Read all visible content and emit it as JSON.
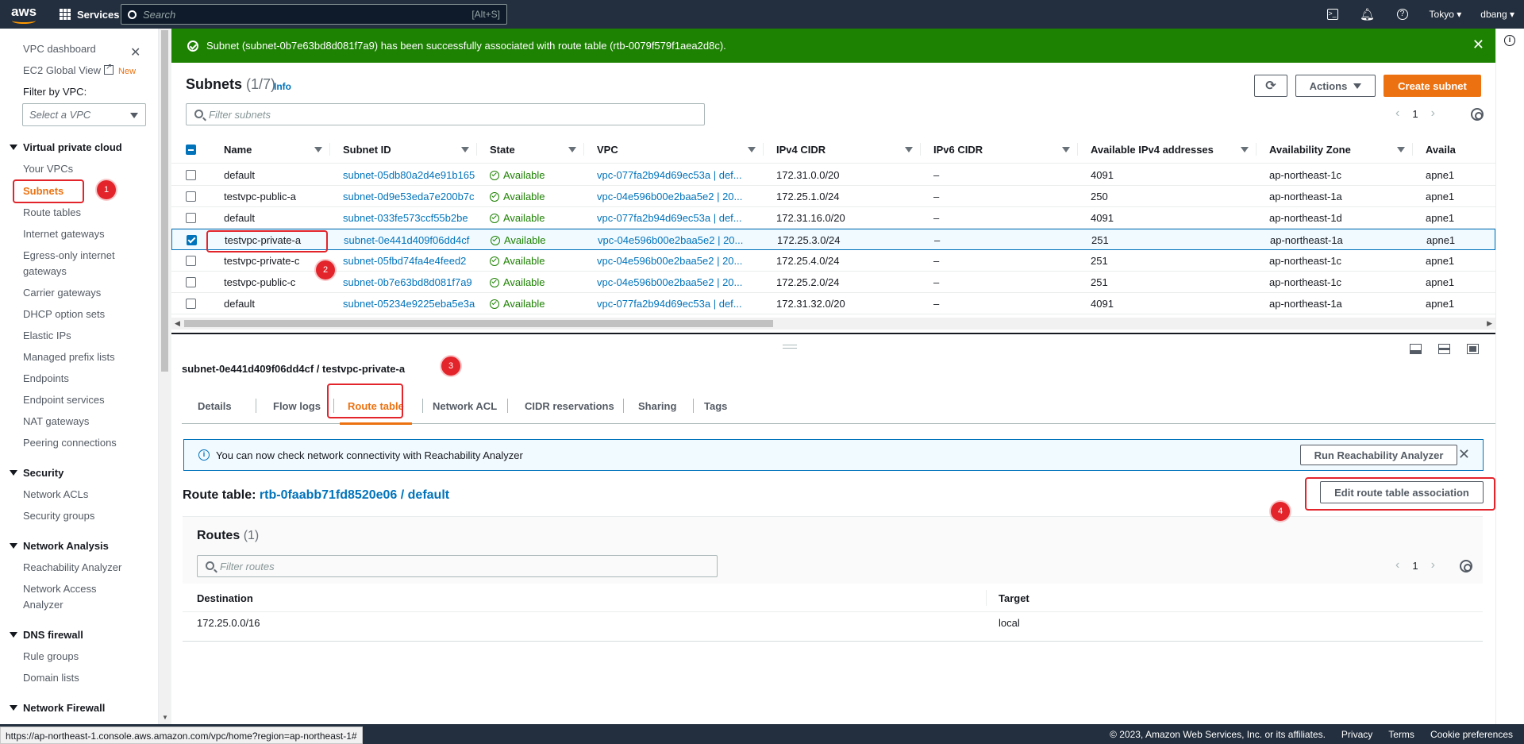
{
  "topnav": {
    "logo": "aws",
    "services_label": "Services",
    "search_placeholder": "Search",
    "search_shortcut": "[Alt+S]",
    "region": "Tokyo",
    "user": "dbang"
  },
  "sidebar": {
    "dashboard": "VPC dashboard",
    "ec2_global": "EC2 Global View",
    "ec2_new": "New",
    "filter_label": "Filter by VPC:",
    "filter_placeholder": "Select a VPC",
    "sections": {
      "vpc": "Virtual private cloud",
      "security": "Security",
      "analysis": "Network Analysis",
      "dns": "DNS firewall",
      "nfw": "Network Firewall"
    },
    "vpc_items": [
      "Your VPCs",
      "Subnets",
      "Route tables",
      "Internet gateways",
      "Egress-only internet",
      "gateways",
      "Carrier gateways",
      "DHCP option sets",
      "Elastic IPs",
      "Managed prefix lists",
      "Endpoints",
      "Endpoint services",
      "NAT gateways",
      "Peering connections"
    ],
    "security_items": [
      "Network ACLs",
      "Security groups"
    ],
    "analysis_items": [
      "Reachability Analyzer",
      "Network Access",
      "Analyzer"
    ],
    "dns_items": [
      "Rule groups",
      "Domain lists"
    ]
  },
  "flash": {
    "message": "Subnet (subnet-0b7e63bd8d081f7a9) has been successfully associated with route table (rtb-0079f579f1aea2d8c)."
  },
  "subnets": {
    "title": "Subnets",
    "count": "(1/7)",
    "info": "Info",
    "actions_label": "Actions",
    "create_label": "Create subnet",
    "filter_placeholder": "Filter subnets",
    "page": "1",
    "columns": [
      "Name",
      "Subnet ID",
      "State",
      "VPC",
      "IPv4 CIDR",
      "IPv6 CIDR",
      "Available IPv4 addresses",
      "Availability Zone",
      "Availa"
    ],
    "rows": [
      {
        "name": "default",
        "id": "subnet-05db80a2d4e91b165",
        "state": "Available",
        "vpc": "vpc-077fa2b94d69ec53a | def...",
        "ipv4": "172.31.0.0/20",
        "ipv6": "–",
        "avail": "4091",
        "az": "ap-northeast-1c",
        "azid": "apne1"
      },
      {
        "name": "testvpc-public-a",
        "id": "subnet-0d9e53eda7e200b7c",
        "state": "Available",
        "vpc": "vpc-04e596b00e2baa5e2 | 20...",
        "ipv4": "172.25.1.0/24",
        "ipv6": "–",
        "avail": "250",
        "az": "ap-northeast-1a",
        "azid": "apne1"
      },
      {
        "name": "default",
        "id": "subnet-033fe573ccf55b2be",
        "state": "Available",
        "vpc": "vpc-077fa2b94d69ec53a | def...",
        "ipv4": "172.31.16.0/20",
        "ipv6": "–",
        "avail": "4091",
        "az": "ap-northeast-1d",
        "azid": "apne1"
      },
      {
        "name": "testvpc-private-a",
        "id": "subnet-0e441d409f06dd4cf",
        "state": "Available",
        "vpc": "vpc-04e596b00e2baa5e2 | 20...",
        "ipv4": "172.25.3.0/24",
        "ipv6": "–",
        "avail": "251",
        "az": "ap-northeast-1a",
        "azid": "apne1"
      },
      {
        "name": "testvpc-private-c",
        "id": "subnet-05fbd74fa4e4feed2",
        "state": "Available",
        "vpc": "vpc-04e596b00e2baa5e2 | 20...",
        "ipv4": "172.25.4.0/24",
        "ipv6": "–",
        "avail": "251",
        "az": "ap-northeast-1c",
        "azid": "apne1"
      },
      {
        "name": "testvpc-public-c",
        "id": "subnet-0b7e63bd8d081f7a9",
        "state": "Available",
        "vpc": "vpc-04e596b00e2baa5e2 | 20...",
        "ipv4": "172.25.2.0/24",
        "ipv6": "–",
        "avail": "251",
        "az": "ap-northeast-1c",
        "azid": "apne1"
      },
      {
        "name": "default",
        "id": "subnet-05234e9225eba5e3a",
        "state": "Available",
        "vpc": "vpc-077fa2b94d69ec53a | def...",
        "ipv4": "172.31.32.0/20",
        "ipv6": "–",
        "avail": "4091",
        "az": "ap-northeast-1a",
        "azid": "apne1"
      }
    ]
  },
  "detail": {
    "title": "subnet-0e441d409f06dd4cf / testvpc-private-a",
    "tabs": [
      "Details",
      "Flow logs",
      "Route table",
      "Network ACL",
      "CIDR reservations",
      "Sharing",
      "Tags"
    ],
    "alert_text": "You can now check network connectivity with Reachability Analyzer",
    "alert_button": "Run Reachability Analyzer",
    "rt_label": "Route table:",
    "rt_value": "rtb-0faabb71fd8520e06 / default",
    "edit_button": "Edit route table association",
    "routes_title": "Routes",
    "routes_count": "(1)",
    "routes_filter": "Filter routes",
    "routes_page": "1",
    "routes_columns": [
      "Destination",
      "Target"
    ],
    "routes_rows": [
      {
        "destination": "172.25.0.0/16",
        "target": "local"
      }
    ]
  },
  "annotations": [
    "1",
    "2",
    "3",
    "4"
  ],
  "footer": {
    "copyright": "© 2023, Amazon Web Services, Inc. or its affiliates.",
    "privacy": "Privacy",
    "terms": "Terms",
    "cookies": "Cookie preferences"
  },
  "status_url": "https://ap-northeast-1.console.aws.amazon.com/vpc/home?region=ap-northeast-1#"
}
